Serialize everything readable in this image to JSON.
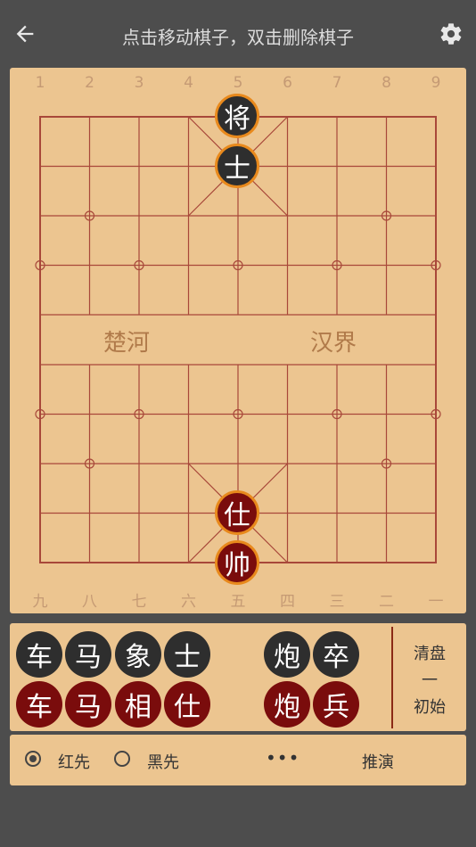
{
  "header": {
    "title": "点击移动棋子，双击删除棋子",
    "back_icon": "arrow-left-icon",
    "settings_icon": "gear-icon"
  },
  "board": {
    "top_labels": [
      "1",
      "2",
      "3",
      "4",
      "5",
      "6",
      "7",
      "8",
      "9"
    ],
    "bottom_labels": [
      "九",
      "八",
      "七",
      "六",
      "五",
      "四",
      "三",
      "二",
      "一"
    ],
    "river_left": "楚河",
    "river_right": "汉界",
    "pieces": {
      "black_general": "将",
      "black_advisor": "士",
      "red_advisor": "仕",
      "red_general": "帅"
    }
  },
  "tray": {
    "black": [
      "车",
      "马",
      "象",
      "士",
      "炮",
      "卒"
    ],
    "red": [
      "车",
      "马",
      "相",
      "仕",
      "炮",
      "兵"
    ],
    "clear_label": "清盘",
    "dash": "一",
    "initial_label": "初始"
  },
  "bottom": {
    "red_first": "红先",
    "black_first": "黑先",
    "selected": "红先",
    "more": "•••",
    "deduce": "推演"
  },
  "colors": {
    "board": "#ecc590",
    "grid": "#a8483a",
    "red_piece": "#7a0c0c",
    "black_piece": "#2e2e2e",
    "piece_border": "#e8891c"
  }
}
